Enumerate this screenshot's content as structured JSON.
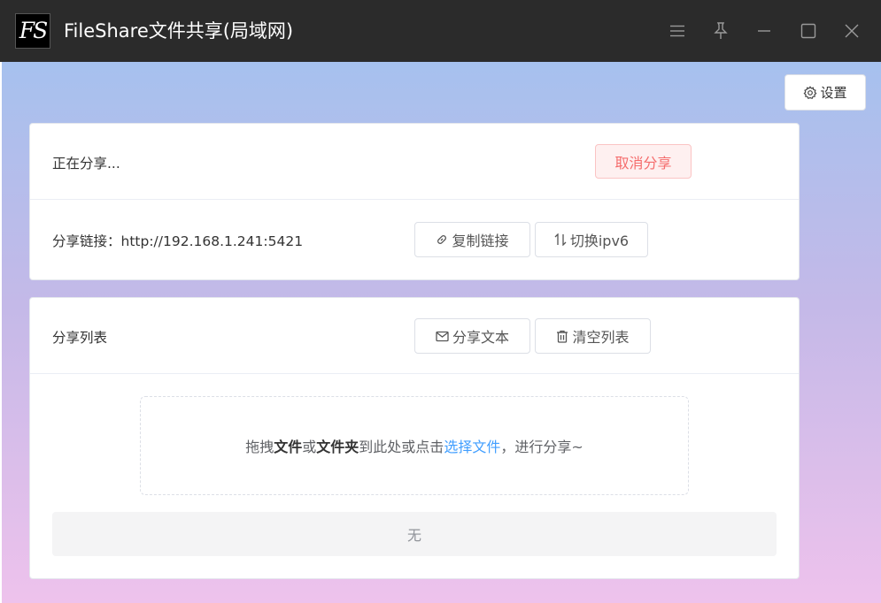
{
  "titlebar": {
    "logo_text": "FS",
    "title": "FileShare文件共享(局域网)",
    "buttons": [
      "menu-icon",
      "pin-icon",
      "minimize-icon",
      "maximize-icon",
      "close-icon"
    ]
  },
  "toolbar": {
    "settings_label": "设置",
    "settings_icon": "gear-icon"
  },
  "share_status": {
    "status_text": "正在分享...",
    "cancel_label": "取消分享",
    "link_label": "分享链接：",
    "link_url": "http://192.168.1.241:5421",
    "copy_label": "复制链接",
    "copy_icon": "link-icon",
    "ipv6_label": "切换ipv6",
    "ipv6_icon": "swap-icon"
  },
  "share_list": {
    "title": "分享列表",
    "share_text_label": "分享文本",
    "share_text_icon": "mail-icon",
    "clear_label": "清空列表",
    "clear_icon": "trash-icon",
    "dropzone": {
      "part1": "拖拽",
      "bold1": "文件",
      "part2": "或",
      "bold2": "文件夹",
      "part3": "到此处或点击",
      "link": "选择文件",
      "part4": "，进行分享~"
    },
    "empty_text": "无"
  },
  "colors": {
    "titlebar_bg": "#2b2b2b",
    "danger": "#f56c6c",
    "link": "#409eff",
    "gradient_top": "#a6c1ee",
    "gradient_bottom": "#eec2ec"
  }
}
